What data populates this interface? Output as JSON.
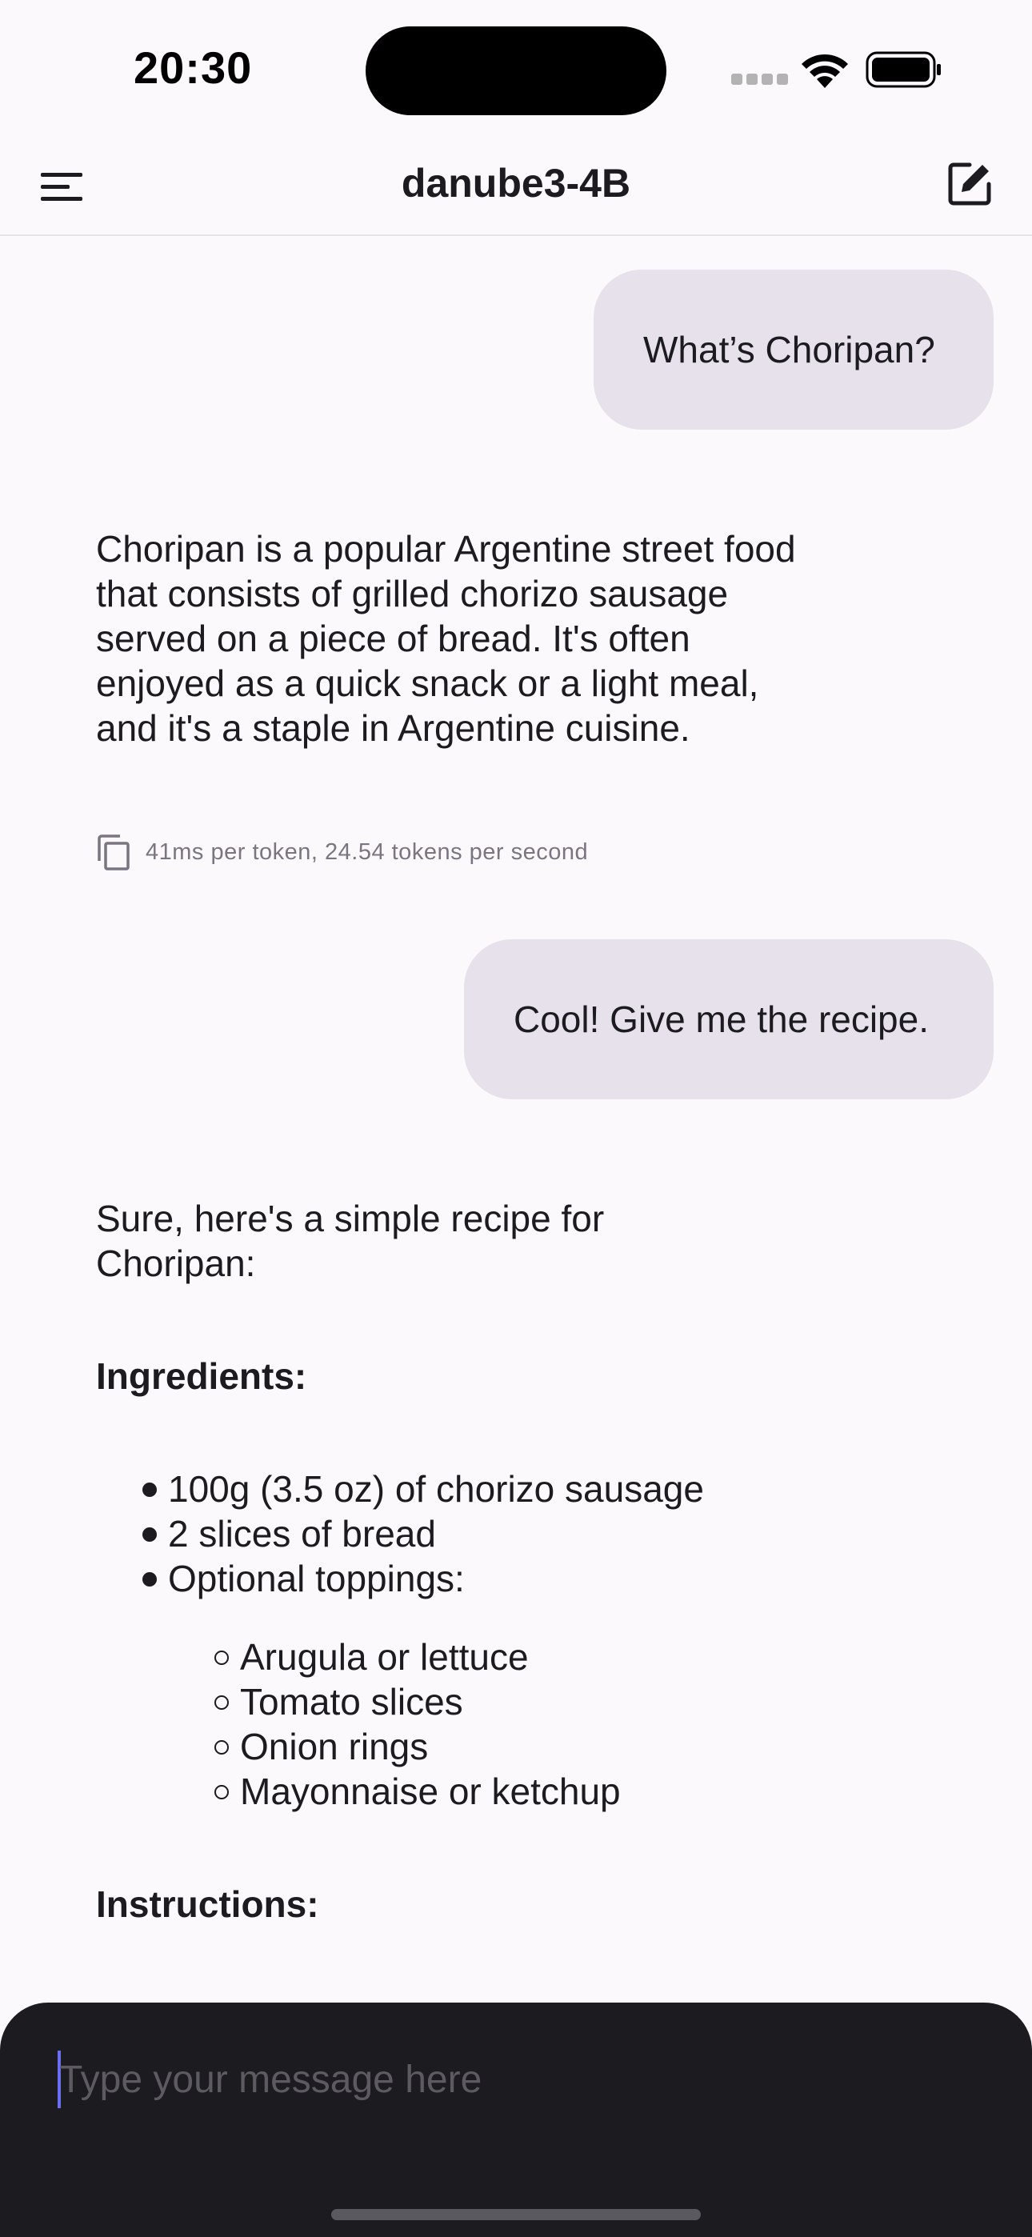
{
  "status_bar": {
    "time": "20:30"
  },
  "app_bar": {
    "title": "danube3-4B"
  },
  "messages": [
    {
      "role": "user",
      "text": "What’s Choripan?"
    },
    {
      "role": "assistant",
      "text": "Choripan is a popular Argentine street food that consists of grilled chorizo sausage served on a piece of bread. It's often enjoyed as a quick snack or a light meal, and it's a staple in Argentine cuisine.",
      "stats": "41ms per token, 24.54 tokens per second"
    },
    {
      "role": "user",
      "text": "Cool! Give me the recipe."
    }
  ],
  "recipe": {
    "intro": "Sure, here's a simple recipe for Choripan:",
    "ingredients_heading": "Ingredients:",
    "ingredients": [
      "100g (3.5 oz) of chorizo sausage",
      "2 slices of bread",
      "Optional toppings:"
    ],
    "toppings": [
      "Arugula or lettuce",
      "Tomato slices",
      "Onion rings",
      "Mayonnaise or ketchup"
    ],
    "instructions_heading": "Instructions:"
  },
  "composer": {
    "placeholder": "Type your message here"
  },
  "icons": {
    "menu": "menu-icon",
    "edit": "edit-icon",
    "copy": "copy-icon"
  }
}
